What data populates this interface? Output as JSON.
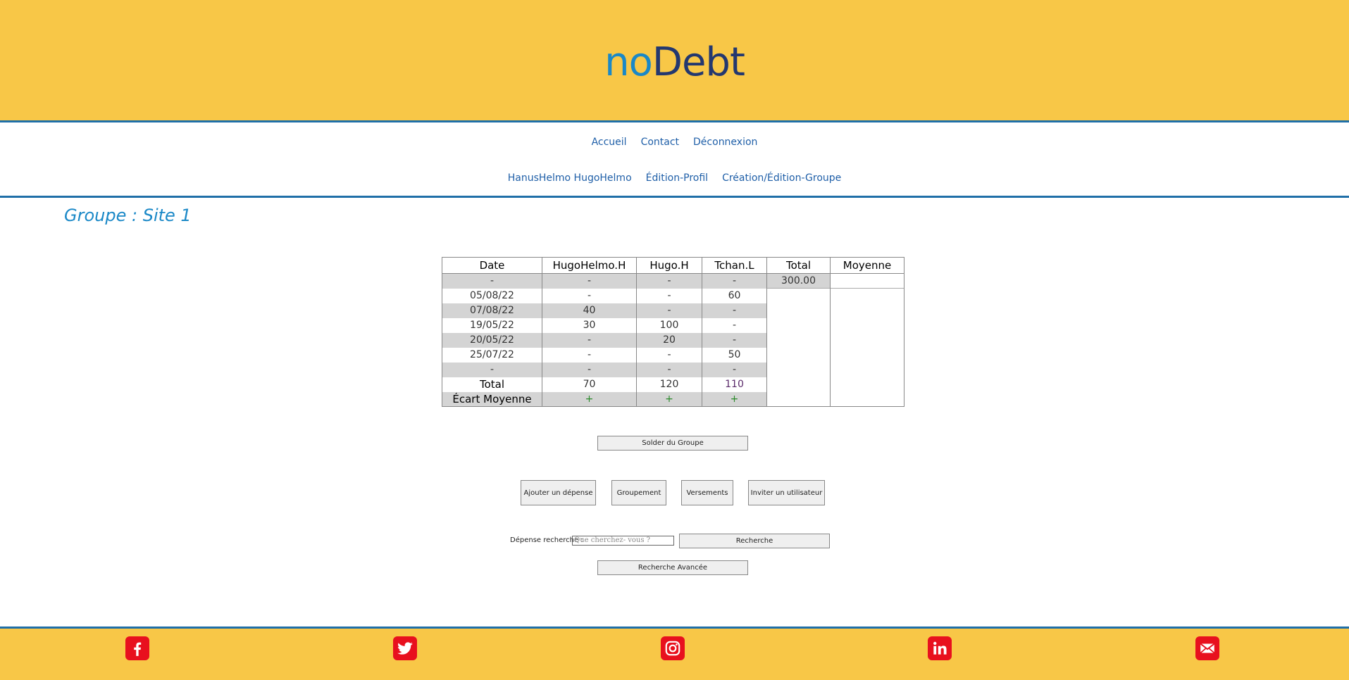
{
  "brand": {
    "part1": "no",
    "part2": "Debt"
  },
  "nav": {
    "row1": [
      "Accueil",
      "Contact",
      "Déconnexion"
    ],
    "row2": [
      "HanusHelmo HugoHelmo",
      "Édition-Profil",
      "Création/Édition-Groupe"
    ]
  },
  "group_title": "Groupe : Site 1",
  "table": {
    "headers": [
      "Date",
      "HugoHelmo.H",
      "Hugo.H",
      "Tchan.L",
      "Total",
      "Moyenne"
    ],
    "rows": [
      [
        "-",
        "-",
        "-",
        "-"
      ],
      [
        "05/08/22",
        "-",
        "-",
        "60"
      ],
      [
        "07/08/22",
        "40",
        "-",
        "-"
      ],
      [
        "19/05/22",
        "30",
        "100",
        "-"
      ],
      [
        "20/05/22",
        "-",
        "20",
        "-"
      ],
      [
        "25/07/22",
        "-",
        "-",
        "50"
      ],
      [
        "-",
        "-",
        "-",
        "-"
      ]
    ],
    "total_value": "300.00",
    "total_row": [
      "Total",
      "70",
      "120",
      "110"
    ],
    "ecart_row": [
      "Écart Moyenne",
      "+",
      "+",
      "+"
    ]
  },
  "buttons": {
    "solder": "Solder du Groupe",
    "ajouter": "Ajouter un dépense",
    "groupement": "Groupement",
    "versements": "Versements",
    "inviter": "Inviter un utilisateur",
    "recherche": "Recherche",
    "recherche_avancee": "Recherche Avancée"
  },
  "search": {
    "label": "Dépense recherche :",
    "placeholder": "Que cherchez- vous ?"
  },
  "footer_icons": [
    "facebook-icon",
    "twitter-icon",
    "instagram-icon",
    "linkedin-icon",
    "mail-icon"
  ],
  "colors": {
    "header_bg": "#f8c747",
    "rule": "#1f6fa8",
    "logo_no": "#1a88c7",
    "logo_debt": "#24386f",
    "social": "#e8101e"
  }
}
